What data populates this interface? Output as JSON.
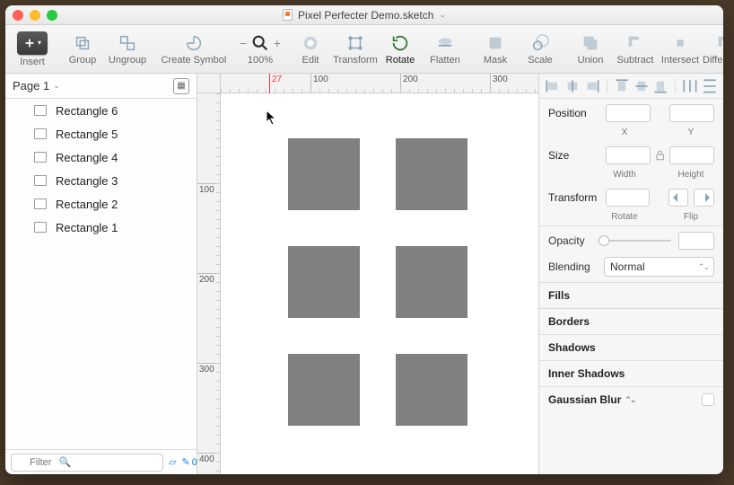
{
  "titlebar": {
    "filename": "Pixel Perfecter Demo.sketch"
  },
  "toolbar": {
    "insert": "Insert",
    "group": "Group",
    "ungroup": "Ungroup",
    "create_symbol": "Create Symbol",
    "zoom_pct": "100%",
    "edit": "Edit",
    "transform": "Transform",
    "rotate": "Rotate",
    "flatten": "Flatten",
    "mask": "Mask",
    "scale": "Scale",
    "union": "Union",
    "subtract": "Subtract",
    "intersect": "Intersect",
    "difference": "Difference"
  },
  "left": {
    "page_label": "Page 1",
    "layers": [
      "Rectangle 6",
      "Rectangle 5",
      "Rectangle 4",
      "Rectangle 3",
      "Rectangle 2",
      "Rectangle 1"
    ],
    "filter_placeholder": "Filter",
    "count": "0"
  },
  "ruler": {
    "cursor_x": "27",
    "h_labels": [
      "100",
      "200",
      "300"
    ],
    "v_labels": [
      "100",
      "200",
      "300",
      "400"
    ]
  },
  "inspector": {
    "position": "Position",
    "x": "X",
    "y": "Y",
    "size": "Size",
    "width": "Width",
    "height": "Height",
    "transform": "Transform",
    "rotate": "Rotate",
    "flip": "Flip",
    "opacity": "Opacity",
    "blending": "Blending",
    "blend_mode": "Normal",
    "fills": "Fills",
    "borders": "Borders",
    "shadows": "Shadows",
    "inner_shadows": "Inner Shadows",
    "gaussian": "Gaussian Blur"
  }
}
